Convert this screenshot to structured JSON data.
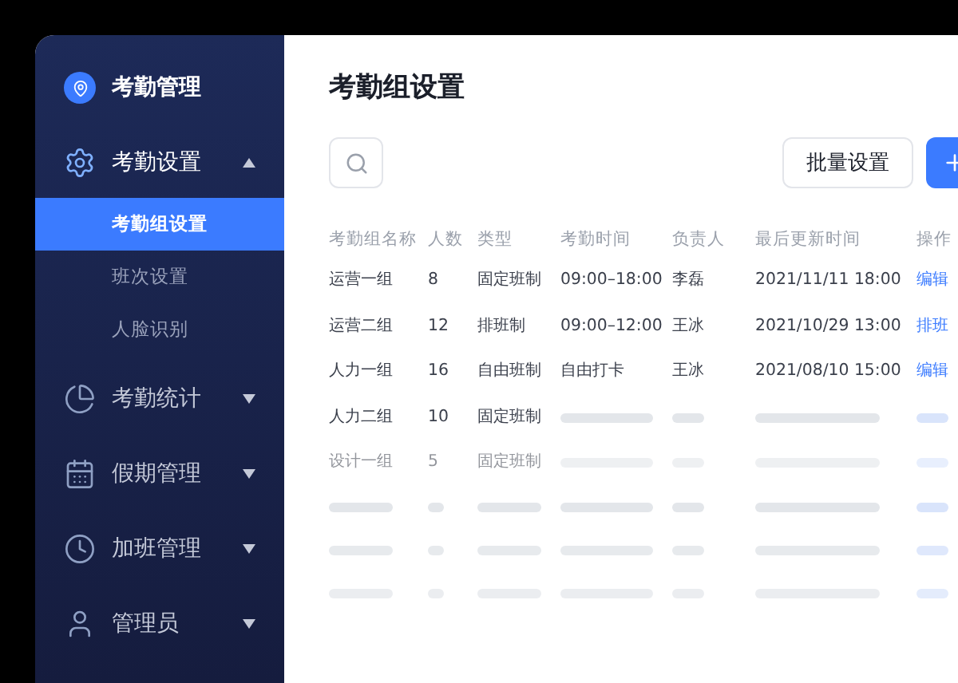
{
  "app": {
    "title": "考勤管理"
  },
  "menu": [
    {
      "label": "考勤设置",
      "expanded": true,
      "children": [
        {
          "label": "考勤组设置",
          "selected": true
        },
        {
          "label": "班次设置",
          "selected": false
        },
        {
          "label": "人脸识别",
          "selected": false
        }
      ]
    },
    {
      "label": "考勤统计",
      "expanded": false
    },
    {
      "label": "假期管理",
      "expanded": false
    },
    {
      "label": "加班管理",
      "expanded": false
    },
    {
      "label": "管理员",
      "expanded": false
    }
  ],
  "page": {
    "title": "考勤组设置",
    "buttons": [
      {
        "label": "批量设置"
      }
    ]
  },
  "table": {
    "columns": [
      "考勤组名称",
      "人数",
      "类型",
      "考勤时间",
      "负责人",
      "最后更新时间",
      "操作"
    ],
    "rows": [
      {
        "cells": [
          "运营一组",
          "8",
          "固定班制",
          "09:00–18:00",
          "李磊",
          "2021/11/11 18:00",
          "编辑"
        ],
        "dimmed": false
      },
      {
        "cells": [
          "运营二组",
          "12",
          "排班制",
          "09:00–12:00",
          "王冰",
          "2021/10/29 13:00",
          "排班"
        ],
        "dimmed": false
      },
      {
        "cells": [
          "人力一组",
          "16",
          "自由班制",
          "自由打卡",
          "王冰",
          "2021/08/10 15:00",
          "编辑"
        ],
        "dimmed": false
      },
      {
        "cells": [
          "人力二组",
          "10",
          "固定班制"
        ],
        "dimmed": false
      },
      {
        "cells": [
          "设计一组",
          "5",
          "固定班制"
        ],
        "dimmed": true
      }
    ]
  }
}
